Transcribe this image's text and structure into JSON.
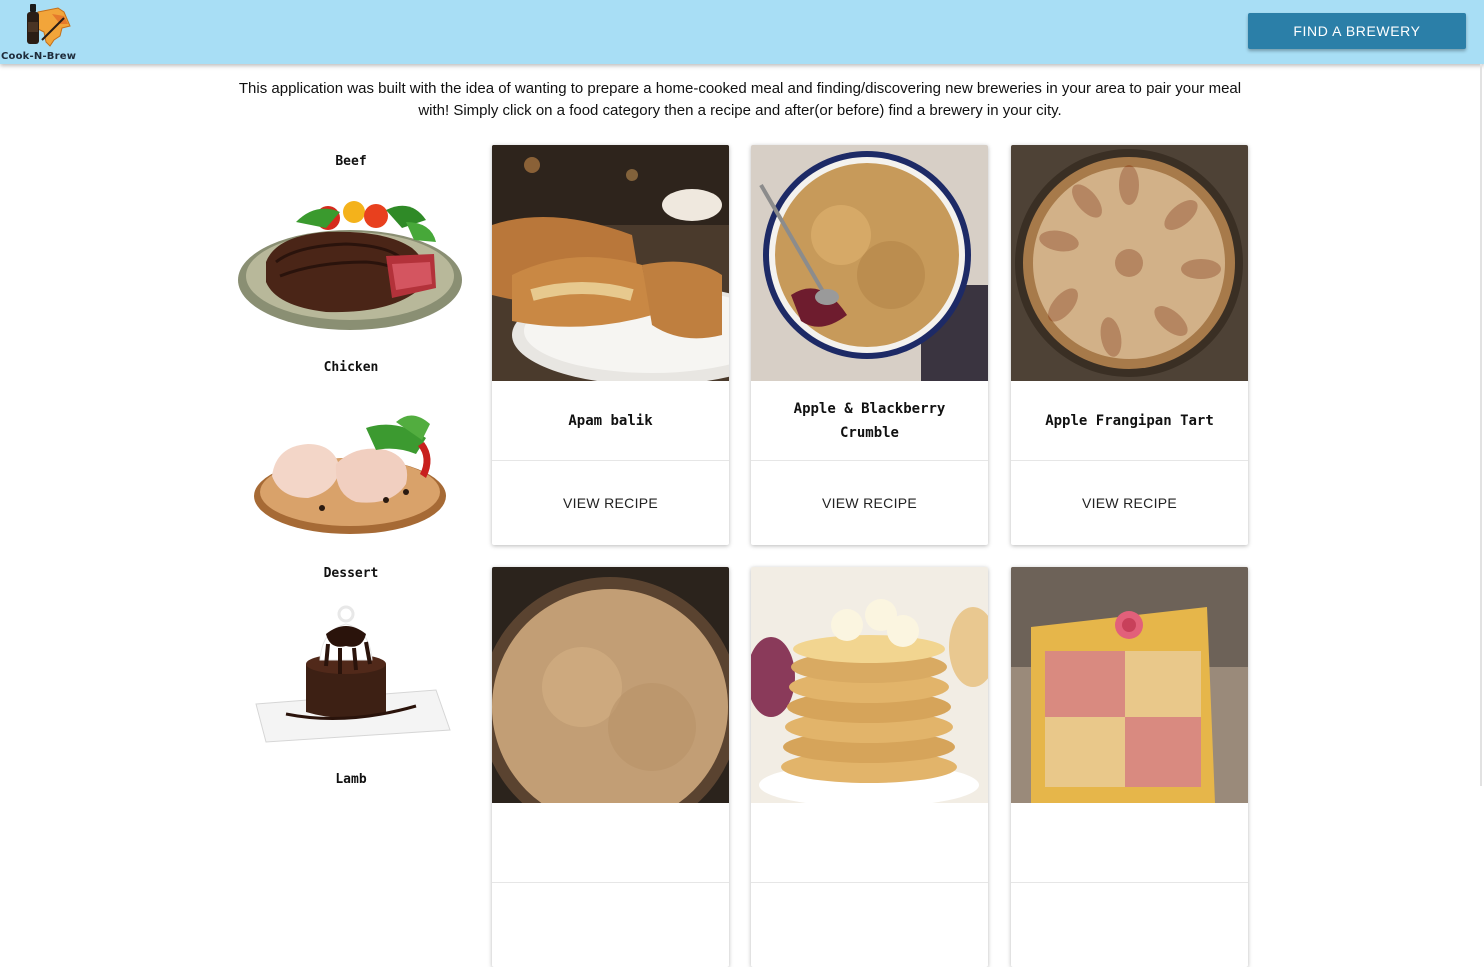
{
  "navbar": {
    "logo_text": "Cook-N-Brew",
    "find_brewery_label": "FIND A BREWERY"
  },
  "intro_text": "This application was built with the idea of wanting to prepare a home-cooked meal and finding/discovering new breweries in your area to pair your meal with! Simply click on a food category then a recipe and after(or before) find a brewery in your city.",
  "categories": [
    {
      "label": "Beef"
    },
    {
      "label": "Chicken"
    },
    {
      "label": "Dessert"
    },
    {
      "label": "Lamb"
    }
  ],
  "recipes": [
    {
      "title": "Apam balik",
      "action": "VIEW RECIPE"
    },
    {
      "title": "Apple & Blackberry Crumble",
      "action": "VIEW RECIPE"
    },
    {
      "title": "Apple Frangipan Tart",
      "action": "VIEW RECIPE"
    },
    {
      "title": "",
      "action": ""
    },
    {
      "title": "",
      "action": ""
    },
    {
      "title": "",
      "action": ""
    }
  ],
  "colors": {
    "navbar_bg": "#a8def5",
    "button_bg": "#2b7fa8",
    "button_text": "#ffffff"
  }
}
